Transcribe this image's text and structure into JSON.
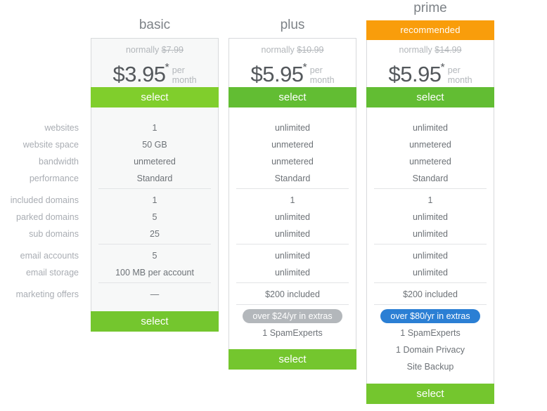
{
  "colors": {
    "green_basic": "#80ce2c",
    "green_plus": "#62bd33",
    "green_prime": "#62bd33",
    "green_bottom": "#74c62e",
    "orange_recommended": "#f99d0b",
    "pill_gray": "#b3b7bb",
    "pill_blue": "#2b7fd4",
    "label_gray": "#a9adb3",
    "value_gray": "#6d7277",
    "card_border": "#d8dadc",
    "card_shaded_bg": "#f7f8f8"
  },
  "feature_labels": [
    "websites",
    "website space",
    "bandwidth",
    "performance",
    "included domains",
    "parked domains",
    "sub domains",
    "email accounts",
    "email storage",
    "marketing offers"
  ],
  "plans": [
    {
      "name": "basic",
      "ribbon": null,
      "normally_prefix": "normally",
      "normally_price": "$7.99",
      "price": "$3.95",
      "price_star": "*",
      "per": "per",
      "month": "month",
      "select_top": "select",
      "select_bottom": "select",
      "features": [
        "1",
        "50 GB",
        "unmetered",
        "Standard",
        "1",
        "5",
        "25",
        "5",
        "100 MB per account",
        "—"
      ],
      "extras_pill": null,
      "extras": []
    },
    {
      "name": "plus",
      "ribbon": null,
      "normally_prefix": "normally",
      "normally_price": "$10.99",
      "price": "$5.95",
      "price_star": "*",
      "per": "per",
      "month": "month",
      "select_top": "select",
      "select_bottom": "select",
      "features": [
        "unlimited",
        "unmetered",
        "unmetered",
        "Standard",
        "1",
        "unlimited",
        "unlimited",
        "unlimited",
        "unlimited",
        "$200 included"
      ],
      "extras_pill": "over $24/yr in extras",
      "extras": [
        "1 SpamExperts"
      ]
    },
    {
      "name": "prime",
      "ribbon": "recommended",
      "normally_prefix": "normally",
      "normally_price": "$14.99",
      "price": "$5.95",
      "price_star": "*",
      "per": "per",
      "month": "month",
      "select_top": "select",
      "select_bottom": "select",
      "features": [
        "unlimited",
        "unmetered",
        "unmetered",
        "Standard",
        "1",
        "unlimited",
        "unlimited",
        "unlimited",
        "unlimited",
        "$200 included"
      ],
      "extras_pill": "over $80/yr in extras",
      "extras": [
        "1 SpamExperts",
        "1 Domain Privacy",
        "Site Backup"
      ]
    }
  ]
}
